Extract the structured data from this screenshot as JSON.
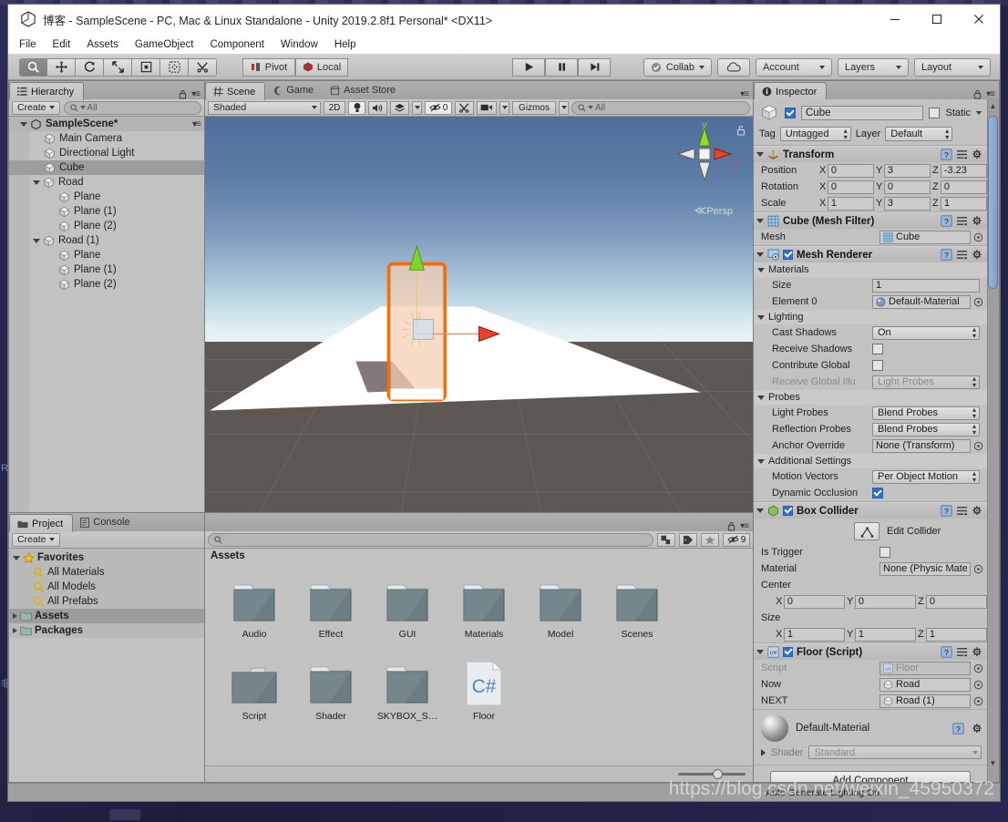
{
  "window": {
    "title": "博客 - SampleScene - PC, Mac & Linux Standalone - Unity 2019.2.8f1 Personal* <DX11>",
    "minimize_label": "—",
    "maximize_label": "▢",
    "close_label": "✕",
    "logo_name": "unity-logo"
  },
  "menubar": {
    "items": [
      "File",
      "Edit",
      "Assets",
      "GameObject",
      "Component",
      "Window",
      "Help"
    ]
  },
  "toolbar": {
    "tools": [
      {
        "name": "hand-tool",
        "glyph": "✋",
        "active": false
      },
      {
        "name": "move-tool",
        "glyph": "✥",
        "active": false
      },
      {
        "name": "rotate-tool",
        "glyph": "⟳",
        "active": false
      },
      {
        "name": "scale-tool",
        "glyph": "⤢",
        "active": false
      },
      {
        "name": "rect-tool",
        "glyph": "▣",
        "active": false
      },
      {
        "name": "transform-tool",
        "glyph": "✦",
        "active": false
      },
      {
        "name": "custom-editor-tool",
        "glyph": "✂",
        "active": false
      }
    ],
    "pivot_label": "Pivot",
    "local_label": "Local",
    "play_label": "▶",
    "pause_label": "❚❚",
    "step_label": "▶❙",
    "collab_label": "Collab",
    "cloud_label": "☁",
    "account_label": "Account",
    "layers_label": "Layers",
    "layout_label": "Layout"
  },
  "hierarchy": {
    "tab_label": "Hierarchy",
    "create_label": "Create",
    "search_placeholder": "All",
    "scene_name": "SampleScene*",
    "items": [
      {
        "label": "Main Camera",
        "depth": 1,
        "expandable": false,
        "selected": false
      },
      {
        "label": "Directional Light",
        "depth": 1,
        "expandable": false,
        "selected": false
      },
      {
        "label": "Cube",
        "depth": 1,
        "expandable": false,
        "selected": true
      },
      {
        "label": "Road",
        "depth": 1,
        "expandable": true,
        "selected": false
      },
      {
        "label": "Plane",
        "depth": 2,
        "expandable": false,
        "selected": false
      },
      {
        "label": "Plane (1)",
        "depth": 2,
        "expandable": false,
        "selected": false
      },
      {
        "label": "Plane (2)",
        "depth": 2,
        "expandable": false,
        "selected": false
      },
      {
        "label": "Road (1)",
        "depth": 1,
        "expandable": true,
        "selected": false
      },
      {
        "label": "Plane",
        "depth": 2,
        "expandable": false,
        "selected": false
      },
      {
        "label": "Plane (1)",
        "depth": 2,
        "expandable": false,
        "selected": false
      },
      {
        "label": "Plane (2)",
        "depth": 2,
        "expandable": false,
        "selected": false
      }
    ]
  },
  "scene": {
    "tabs": [
      {
        "label": "Scene",
        "icon": "grid-icon",
        "active": true
      },
      {
        "label": "Game",
        "icon": "gamepad-icon",
        "active": false
      },
      {
        "label": "Asset Store",
        "icon": "store-icon",
        "active": false
      }
    ],
    "shading_mode": "Shaded",
    "toggle_2d": "2D",
    "lighting_icon": "lightbulb-icon",
    "audio_icon": "speaker-icon",
    "fx_icon": "effects-icon",
    "hidden_count": "0",
    "scene_vis_icon": "eye-off-icon",
    "tools_icon": "tools-icon",
    "camera_icon": "camera-icon",
    "gizmos_label": "Gizmos",
    "search_placeholder": "All",
    "persp_label": "Persp",
    "axis_y": "y",
    "axis_x": "x"
  },
  "project": {
    "tabs": [
      {
        "label": "Project",
        "icon": "folder-icon",
        "active": true
      },
      {
        "label": "Console",
        "icon": "console-icon",
        "active": false
      }
    ],
    "create_label": "Create",
    "search_placeholder": "",
    "hidden_packages_count": "9",
    "tree": [
      {
        "label": "Favorites",
        "icon": "star-icon",
        "depth": 0,
        "expanded": true,
        "bold": true,
        "selected": false
      },
      {
        "label": "All Materials",
        "icon": "search-icon",
        "depth": 1,
        "expanded": false,
        "bold": false,
        "selected": false
      },
      {
        "label": "All Models",
        "icon": "search-icon",
        "depth": 1,
        "expanded": false,
        "bold": false,
        "selected": false
      },
      {
        "label": "All Prefabs",
        "icon": "search-icon",
        "depth": 1,
        "expanded": false,
        "bold": false,
        "selected": false
      },
      {
        "label": "Assets",
        "icon": "folder-icon",
        "depth": 0,
        "expanded": false,
        "bold": true,
        "selected": true
      },
      {
        "label": "Packages",
        "icon": "folder-icon",
        "depth": 0,
        "expanded": false,
        "bold": true,
        "selected": false
      }
    ],
    "breadcrumb": "Assets",
    "assets": [
      {
        "label": "Audio",
        "type": "folder"
      },
      {
        "label": "Effect",
        "type": "folder"
      },
      {
        "label": "GUI",
        "type": "folder"
      },
      {
        "label": "Materials",
        "type": "folder"
      },
      {
        "label": "Model",
        "type": "folder"
      },
      {
        "label": "Scenes",
        "type": "folder"
      },
      {
        "label": "Script",
        "type": "folder-open"
      },
      {
        "label": "Shader",
        "type": "folder"
      },
      {
        "label": "SKYBOX_S…",
        "type": "folder"
      },
      {
        "label": "Floor",
        "type": "csharp"
      }
    ]
  },
  "inspector": {
    "tab_label": "Inspector",
    "object_name": "Cube",
    "enabled": true,
    "static_label": "Static",
    "static_checked": false,
    "tag_label": "Tag",
    "tag_value": "Untagged",
    "layer_label": "Layer",
    "layer_value": "Default",
    "components": [
      {
        "name": "Transform",
        "icon": "transform-icon",
        "has_checkbox": false,
        "rows": [
          {
            "label": "Position",
            "type": "xyz",
            "x": "0",
            "y": "3",
            "z": "-3.23"
          },
          {
            "label": "Rotation",
            "type": "xyz",
            "x": "0",
            "y": "0",
            "z": "0"
          },
          {
            "label": "Scale",
            "type": "xyz",
            "x": "1",
            "y": "3",
            "z": "1"
          }
        ]
      },
      {
        "name": "Cube (Mesh Filter)",
        "icon": "mesh-filter-icon",
        "has_checkbox": false,
        "rows": [
          {
            "label": "Mesh",
            "type": "object",
            "value": "Cube",
            "value_icon": "mesh-icon"
          }
        ]
      },
      {
        "name": "Mesh Renderer",
        "icon": "mesh-renderer-icon",
        "has_checkbox": true,
        "checked": true,
        "rows": [
          {
            "label": "Materials",
            "type": "section"
          },
          {
            "label": "Size",
            "type": "text",
            "value": "1",
            "indent": 2
          },
          {
            "label": "Element 0",
            "type": "object",
            "value": "Default-Material",
            "value_icon": "material-icon",
            "indent": 2
          },
          {
            "label": "Lighting",
            "type": "section"
          },
          {
            "label": "Cast Shadows",
            "type": "dropdown",
            "value": "On",
            "indent": 2
          },
          {
            "label": "Receive Shadows",
            "type": "checkbox",
            "checked": false,
            "indent": 2
          },
          {
            "label": "Contribute Global",
            "type": "checkbox",
            "checked": false,
            "indent": 2
          },
          {
            "label": "Receive Global Illu",
            "type": "dropdown",
            "value": "Light Probes",
            "disabled": true,
            "indent": 2
          },
          {
            "label": "Probes",
            "type": "section"
          },
          {
            "label": "Light Probes",
            "type": "dropdown",
            "value": "Blend Probes",
            "indent": 2
          },
          {
            "label": "Reflection Probes",
            "type": "dropdown",
            "value": "Blend Probes",
            "indent": 2
          },
          {
            "label": "Anchor Override",
            "type": "object",
            "value": "None (Transform)",
            "indent": 2
          },
          {
            "label": "Additional Settings",
            "type": "section"
          },
          {
            "label": "Motion Vectors",
            "type": "dropdown",
            "value": "Per Object Motion",
            "indent": 2
          },
          {
            "label": "Dynamic Occlusion",
            "type": "checkbox",
            "checked": true,
            "indent": 2
          }
        ]
      },
      {
        "name": "Box Collider",
        "icon": "box-collider-icon",
        "has_checkbox": true,
        "checked": true,
        "edit_collider_label": "Edit Collider",
        "rows": [
          {
            "label": "Is Trigger",
            "type": "checkbox",
            "checked": false
          },
          {
            "label": "Material",
            "type": "object",
            "value": "None (Physic Mater"
          },
          {
            "label": "Center",
            "type": "xyz-wide",
            "x": "0",
            "y": "0",
            "z": "0"
          },
          {
            "label": "Size",
            "type": "xyz-wide",
            "x": "1",
            "y": "1",
            "z": "1"
          }
        ]
      },
      {
        "name": "Floor (Script)",
        "icon": "csharp-icon",
        "has_checkbox": true,
        "checked": true,
        "rows": [
          {
            "label": "Script",
            "type": "object",
            "value": "Floor",
            "value_icon": "csharp-small-icon",
            "disabled": true
          },
          {
            "label": "Now",
            "type": "object",
            "value": "Road",
            "value_icon": "gameobject-icon"
          },
          {
            "label": "NEXT",
            "type": "object",
            "value": "Road (1)",
            "value_icon": "gameobject-icon"
          }
        ]
      }
    ],
    "material_preview": {
      "name": "Default-Material",
      "shader_label": "Shader",
      "shader_value": "Standard"
    },
    "add_component_label": "Add Component"
  },
  "statusbar": {
    "auto_generate_lighting": "Auto Generate Lighting On",
    "watermark": "https://blog.csdn.net/weixin_45950372"
  }
}
